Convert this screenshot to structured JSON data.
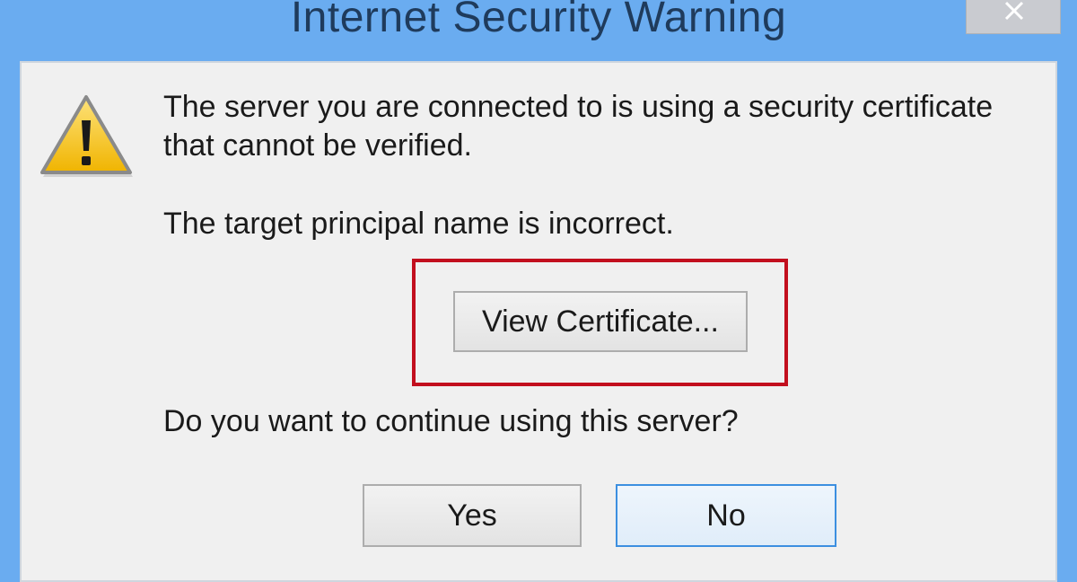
{
  "window": {
    "title": "Internet Security Warning",
    "close_glyph": "✕"
  },
  "dialog": {
    "icon": "warning-icon",
    "message_line1": "The server you are connected to is using a security certificate",
    "message_line2": "that cannot be verified.",
    "detail": "The target principal name is incorrect.",
    "view_certificate_label": "View Certificate...",
    "question": "Do you want to continue using this server?",
    "yes_label": "Yes",
    "no_label": "No"
  },
  "colors": {
    "title_bar": "#6aacf0",
    "highlight_border": "#c20f1e",
    "warning_fill": "#f7c521",
    "default_button_border": "#3c8fe0"
  }
}
